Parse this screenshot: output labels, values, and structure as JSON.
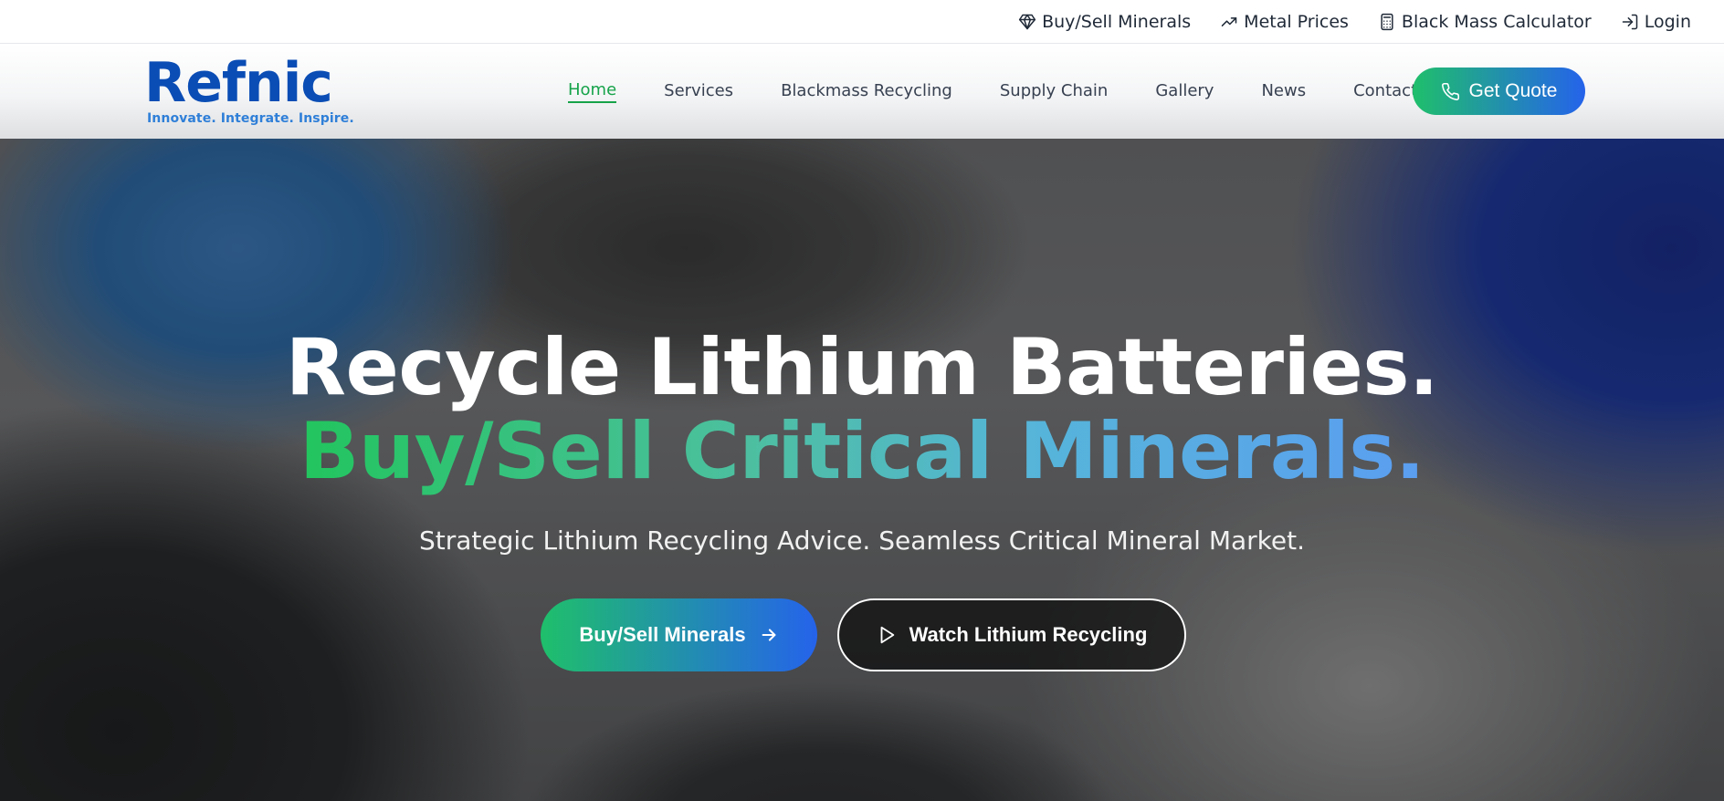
{
  "topbar": {
    "links": [
      {
        "label": "Buy/Sell Minerals",
        "icon": "diamond-icon"
      },
      {
        "label": "Metal Prices",
        "icon": "trending-up-icon"
      },
      {
        "label": "Black Mass Calculator",
        "icon": "calculator-icon"
      },
      {
        "label": "Login",
        "icon": "login-icon"
      }
    ]
  },
  "brand": {
    "name": "Refnic",
    "tagline": "Innovate. Integrate. Inspire.",
    "color": "#0a4db5",
    "tagline_color": "#2f7fd8"
  },
  "nav": {
    "items": [
      {
        "label": "Home",
        "active": true
      },
      {
        "label": "Services"
      },
      {
        "label": "Blackmass Recycling"
      },
      {
        "label": "Supply Chain"
      },
      {
        "label": "Gallery"
      },
      {
        "label": "News"
      },
      {
        "label": "Contact"
      }
    ],
    "cta": {
      "label": "Get Quote",
      "icon": "phone-icon"
    },
    "active_color": "#16a34a"
  },
  "hero": {
    "title_line1": "Recycle Lithium Batteries.",
    "title_line2": "Buy/Sell Critical Minerals.",
    "subtitle": "Strategic Lithium Recycling Advice. Seamless Critical Mineral Market.",
    "primary_button": {
      "label": "Buy/Sell Minerals",
      "icon": "arrow-right-icon"
    },
    "secondary_button": {
      "label": "Watch Lithium Recycling",
      "icon": "play-icon"
    },
    "gradient_colors": [
      "#22c55e",
      "#2563eb"
    ]
  }
}
